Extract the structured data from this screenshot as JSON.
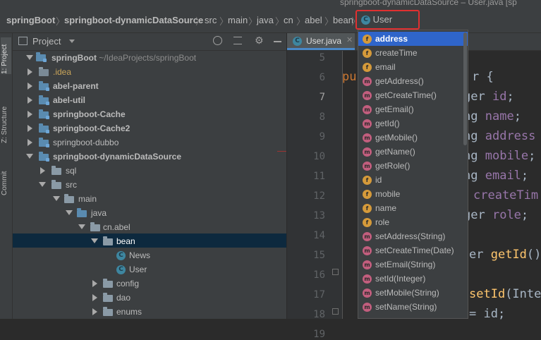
{
  "window": {
    "title": "springboot-dynamicDataSource – User.java [sp"
  },
  "breadcrumb": {
    "items": [
      "springBoot",
      "springboot-dynamicDataSource",
      "src",
      "main",
      "java",
      "cn",
      "abel",
      "bean",
      "User"
    ],
    "separator": "〉",
    "class_icon": "C"
  },
  "sidebar_tabs": {
    "project": "1: Project",
    "structure": "Z: Structure",
    "commit": "Commit"
  },
  "project_panel": {
    "title": "Project",
    "tree": {
      "root": "springBoot",
      "root_path": "~/IdeaProjects/springBoot",
      "idea": ".idea",
      "abel_parent": "abel-parent",
      "abel_util": "abel-util",
      "cache": "springboot-Cache",
      "cache2": "springboot-Cache2",
      "dubbo": "springboot-dubbo",
      "dds": "springboot-dynamicDataSource",
      "sql": "sql",
      "src": "src",
      "main": "main",
      "java": "java",
      "cn_abel": "cn.abel",
      "bean": "bean",
      "news": "News",
      "user": "User",
      "config": "config",
      "dao": "dao",
      "enums": "enums"
    }
  },
  "editor": {
    "tab": "User.java",
    "line_numbers": [
      "5",
      "6",
      "7",
      "8",
      "9",
      "10",
      "11",
      "12",
      "13",
      "14",
      "15",
      "16",
      "17",
      "18",
      "19",
      "20"
    ],
    "code": {
      "l6_kw": "pu",
      "l6_rest": "r {",
      "l7_type": "ger",
      "l7_field": "id",
      "l8_type": "ng",
      "l8_field": "name",
      "l9_type": "ng",
      "l9_field": "address",
      "l10_type": "ng",
      "l10_field": "mobile",
      "l11_type": "ng",
      "l11_field": "email",
      "l12_type": "",
      "l12_field": "createTim",
      "l13_type": "ger",
      "l13_field": "role",
      "l15_type": "er",
      "l15_fn": "getId",
      "l15_rest": "()",
      "l19_fn": "setId",
      "l19_rest": "(Inte",
      "l20_rest": "= id;",
      "semi": ";"
    }
  },
  "structure_popup": {
    "items": [
      {
        "kind": "f",
        "label": "address"
      },
      {
        "kind": "f",
        "label": "createTime"
      },
      {
        "kind": "f",
        "label": "email"
      },
      {
        "kind": "m",
        "label": "getAddress()"
      },
      {
        "kind": "m",
        "label": "getCreateTime()"
      },
      {
        "kind": "m",
        "label": "getEmail()"
      },
      {
        "kind": "m",
        "label": "getId()"
      },
      {
        "kind": "m",
        "label": "getMobile()"
      },
      {
        "kind": "m",
        "label": "getName()"
      },
      {
        "kind": "m",
        "label": "getRole()"
      },
      {
        "kind": "f",
        "label": "id"
      },
      {
        "kind": "f",
        "label": "mobile"
      },
      {
        "kind": "f",
        "label": "name"
      },
      {
        "kind": "f",
        "label": "role"
      },
      {
        "kind": "m",
        "label": "setAddress(String)"
      },
      {
        "kind": "m",
        "label": "setCreateTime(Date)"
      },
      {
        "kind": "m",
        "label": "setEmail(String)"
      },
      {
        "kind": "m",
        "label": "setId(Integer)"
      },
      {
        "kind": "m",
        "label": "setMobile(String)"
      },
      {
        "kind": "m",
        "label": "setName(String)"
      }
    ],
    "selected_label": "address"
  },
  "colors": {
    "highlight_border": "#e03030",
    "selection": "#2f65ca",
    "tree_selection": "#0d293e"
  }
}
